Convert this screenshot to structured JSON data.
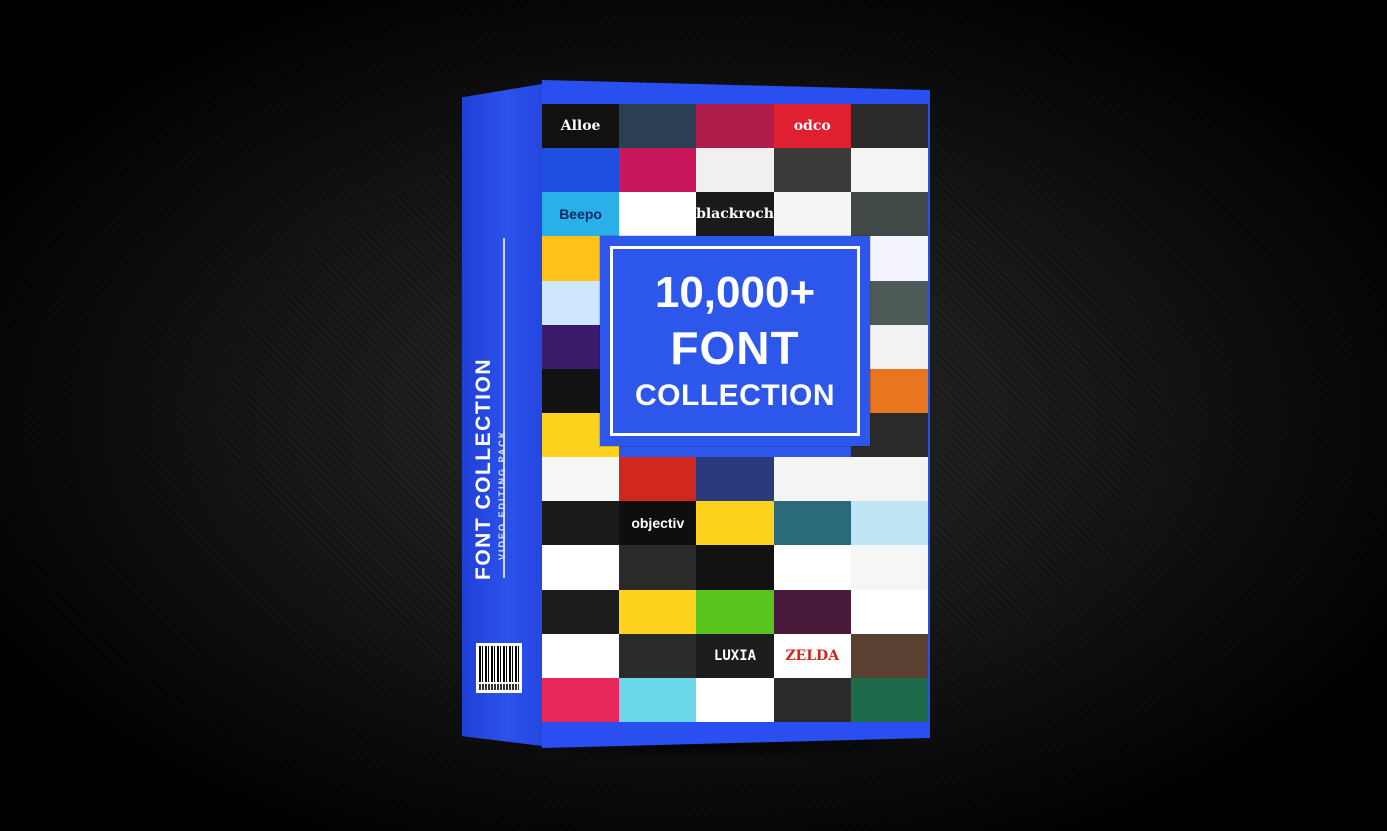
{
  "product": {
    "headline_line1": "10,000+",
    "headline_line2": "FONT",
    "headline_line3": "COLLECTION",
    "spine_title": "FONT COLLECTION",
    "spine_subtitle": "VIDEO EDITING PACK",
    "brand_color": "#2a4ff0"
  },
  "tiles": [
    {
      "text": "Alloe",
      "bg": "#111111",
      "fg": "#ffffff"
    },
    {
      "text": "",
      "bg": "#2a3f52",
      "fg": "#9ad8d0"
    },
    {
      "text": "",
      "bg": "#b11d4a",
      "fg": "#ff7aa0"
    },
    {
      "text": "odco",
      "bg": "#e02030",
      "fg": "#ffffff"
    },
    {
      "text": "",
      "bg": "#2b2b2b",
      "fg": "#e8c020"
    },
    {
      "text": "",
      "bg": "#1e4fe0",
      "fg": "#ffe34a"
    },
    {
      "text": "",
      "bg": "#c8175a",
      "fg": "#ffffff"
    },
    {
      "text": "",
      "bg": "#f0f0f0",
      "fg": "#222222"
    },
    {
      "text": "",
      "bg": "#3a3a3a",
      "fg": "#ffffff"
    },
    {
      "text": "",
      "bg": "#f4f4f4",
      "fg": "#333333"
    },
    {
      "text": "Beepo",
      "bg": "#2ab0e8",
      "fg": "#0d2a66"
    },
    {
      "text": "",
      "bg": "#ffffff",
      "fg": "#333333"
    },
    {
      "text": "blackroch",
      "bg": "#1a1a1a",
      "fg": "#ffffff"
    },
    {
      "text": "",
      "bg": "#f5f5f5",
      "fg": "#111111"
    },
    {
      "text": "",
      "bg": "#404848",
      "fg": "#dddddd"
    },
    {
      "text": "",
      "bg": "#ffc21a",
      "fg": "#222222"
    },
    {
      "text": "",
      "bg": "#2d57ea",
      "fg": "#ffffff"
    },
    {
      "text": "",
      "bg": "#2d57ea",
      "fg": "#ffffff"
    },
    {
      "text": "",
      "bg": "#2d57ea",
      "fg": "#ffffff"
    },
    {
      "text": "",
      "bg": "#f4f4ff",
      "fg": "#6a2be0"
    },
    {
      "text": "",
      "bg": "#cfe6ff",
      "fg": "#222222"
    },
    {
      "text": "",
      "bg": "#2d57ea",
      "fg": "#ffffff"
    },
    {
      "text": "",
      "bg": "#2d57ea",
      "fg": "#ffffff"
    },
    {
      "text": "",
      "bg": "#2d57ea",
      "fg": "#ffffff"
    },
    {
      "text": "",
      "bg": "#4d5a58",
      "fg": "#ffffff"
    },
    {
      "text": "",
      "bg": "#3a1c6a",
      "fg": "#3ff0a0"
    },
    {
      "text": "",
      "bg": "#2d57ea",
      "fg": "#ffffff"
    },
    {
      "text": "",
      "bg": "#2d57ea",
      "fg": "#ffffff"
    },
    {
      "text": "",
      "bg": "#2d57ea",
      "fg": "#ffffff"
    },
    {
      "text": "",
      "bg": "#f2f2f2",
      "fg": "#222222"
    },
    {
      "text": "",
      "bg": "#121212",
      "fg": "#ffffff"
    },
    {
      "text": "",
      "bg": "#2d57ea",
      "fg": "#ffffff"
    },
    {
      "text": "",
      "bg": "#2d57ea",
      "fg": "#ffffff"
    },
    {
      "text": "",
      "bg": "#2d57ea",
      "fg": "#ffffff"
    },
    {
      "text": "",
      "bg": "#e8761e",
      "fg": "#ffffff"
    },
    {
      "text": "",
      "bg": "#ffd21e",
      "fg": "#111111"
    },
    {
      "text": "",
      "bg": "#2d57ea",
      "fg": "#ffffff"
    },
    {
      "text": "",
      "bg": "#2d57ea",
      "fg": "#ffffff"
    },
    {
      "text": "",
      "bg": "#2d57ea",
      "fg": "#ffffff"
    },
    {
      "text": "",
      "bg": "#2b2b2b",
      "fg": "#ffffff"
    },
    {
      "text": "",
      "bg": "#f6f6f6",
      "fg": "#1a6a2a"
    },
    {
      "text": "",
      "bg": "#d0281e",
      "fg": "#ffffff"
    },
    {
      "text": "",
      "bg": "#2a3a7a",
      "fg": "#ffffff"
    },
    {
      "text": "",
      "bg": "#f4f4f4",
      "fg": "#e0401a"
    },
    {
      "text": "",
      "bg": "#f4f4f4",
      "fg": "#111111"
    },
    {
      "text": "",
      "bg": "#1a1a1a",
      "fg": "#dddddd"
    },
    {
      "text": "objectiv",
      "bg": "#0e0e0e",
      "fg": "#ffffff"
    },
    {
      "text": "",
      "bg": "#ffd21e",
      "fg": "#222222"
    },
    {
      "text": "",
      "bg": "#2a6a7a",
      "fg": "#ffffff"
    },
    {
      "text": "",
      "bg": "#bfe6f2",
      "fg": "#ffffff"
    },
    {
      "text": "",
      "bg": "#ffffff",
      "fg": "#333333"
    },
    {
      "text": "",
      "bg": "#2a2a2a",
      "fg": "#ffffff"
    },
    {
      "text": "",
      "bg": "#111111",
      "fg": "#ffffff"
    },
    {
      "text": "",
      "bg": "#ffffff",
      "fg": "#1a3a8a"
    },
    {
      "text": "",
      "bg": "#f6f6f6",
      "fg": "#222222"
    },
    {
      "text": "",
      "bg": "#1c1c1c",
      "fg": "#ffffff"
    },
    {
      "text": "",
      "bg": "#ffd21e",
      "fg": "#e0202a"
    },
    {
      "text": "",
      "bg": "#58c41e",
      "fg": "#ffffff"
    },
    {
      "text": "",
      "bg": "#4a1a3a",
      "fg": "#ff6ab0"
    },
    {
      "text": "",
      "bg": "#ffffff",
      "fg": "#111111"
    },
    {
      "text": "",
      "bg": "#ffffff",
      "fg": "#111111"
    },
    {
      "text": "",
      "bg": "#2a2a2a",
      "fg": "#ffd21e"
    },
    {
      "text": "LUXIA",
      "bg": "#1c1c1c",
      "fg": "#ffffff"
    },
    {
      "text": "ZELDA",
      "bg": "#ffffff",
      "fg": "#d0281e"
    },
    {
      "text": "",
      "bg": "#5a4030",
      "fg": "#ffffff"
    },
    {
      "text": "",
      "bg": "#e8285a",
      "fg": "#ffffff"
    },
    {
      "text": "",
      "bg": "#6ad8e8",
      "fg": "#c028c0"
    },
    {
      "text": "",
      "bg": "#ffffff",
      "fg": "#111111"
    },
    {
      "text": "",
      "bg": "#2a2a2a",
      "fg": "#ffffff"
    },
    {
      "text": "",
      "bg": "#1e6a4a",
      "fg": "#ffffff"
    }
  ]
}
